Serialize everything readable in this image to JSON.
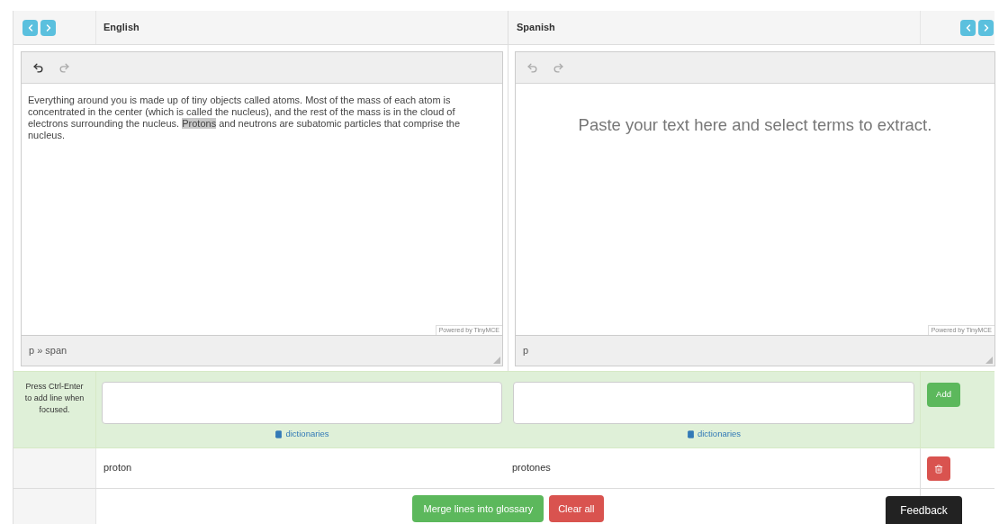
{
  "header": {
    "source_language": "English",
    "target_language": "Spanish"
  },
  "editors": [
    {
      "segments": [
        {
          "text": "Everything around you is made up of tiny objects called atoms. Most of the mass of each atom is concentrated in the center (which is called the nucleus), and the rest of the mass is in the cloud of electrons surrounding the nucleus. ",
          "selected": false
        },
        {
          "text": "Protons",
          "selected": true
        },
        {
          "text": " and neutrons are subatomic particles that comprise the nucleus.",
          "selected": false
        }
      ],
      "branding": "Powered by TinyMCE",
      "path": "p » span",
      "undo_enabled": true
    },
    {
      "placeholder": "Paste your text here and select terms to extract.",
      "branding": "Powered by TinyMCE",
      "path": "p",
      "undo_enabled": false
    }
  ],
  "entry_row": {
    "hint": "Press Ctrl-Enter to add line when focused.",
    "dictionaries_links": [
      "dictionaries",
      "dictionaries"
    ],
    "add_button": "Add"
  },
  "terms": [
    {
      "source": "proton",
      "target": "protones"
    }
  ],
  "actions": {
    "merge_button": "Merge lines into glossary",
    "clear_button": "Clear all"
  },
  "feedback_button": "Feedback"
}
